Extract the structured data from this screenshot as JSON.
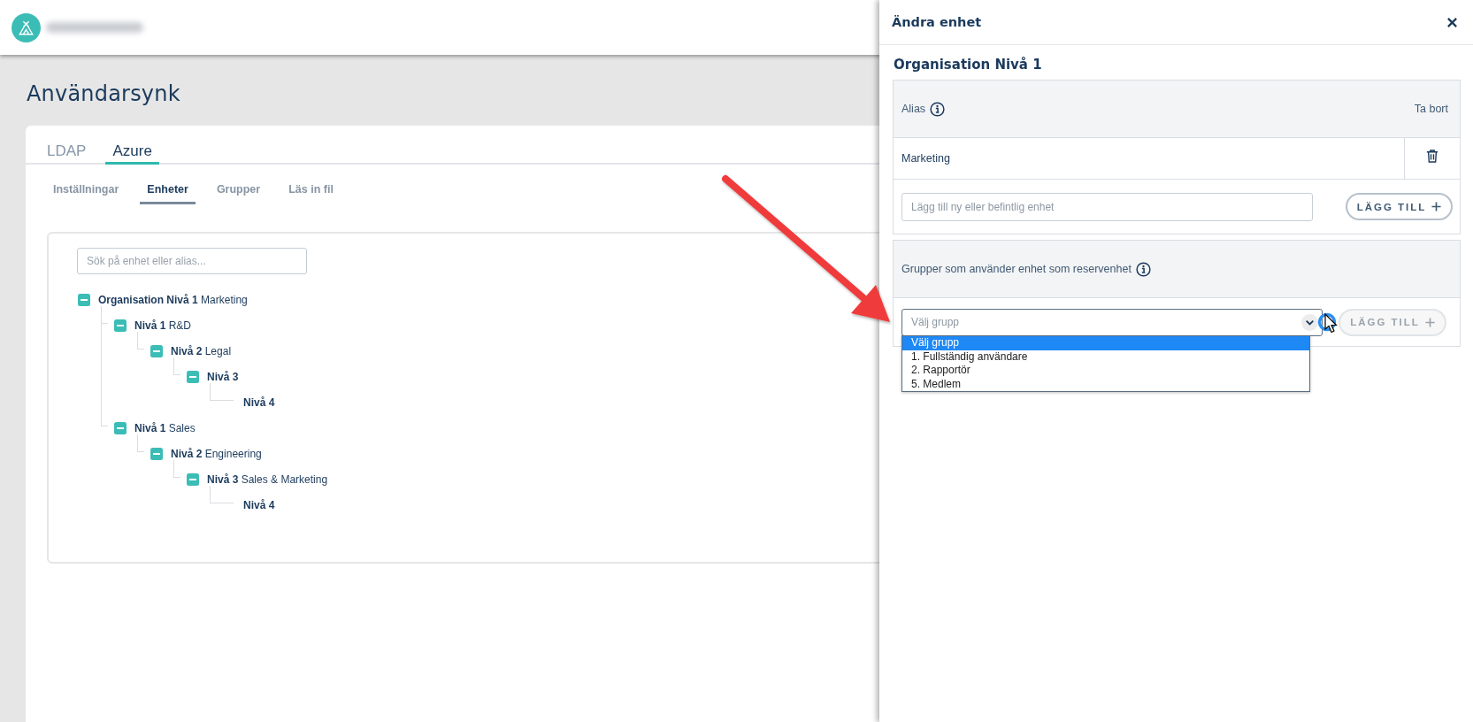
{
  "page_title": "Användarsynk",
  "tabs": [
    {
      "label": "LDAP",
      "selected": false
    },
    {
      "label": "Azure",
      "selected": true
    }
  ],
  "subtabs": [
    {
      "label": "Inställningar",
      "selected": false
    },
    {
      "label": "Enheter",
      "selected": true
    },
    {
      "label": "Grupper",
      "selected": false
    },
    {
      "label": "Läs in fil",
      "selected": false
    }
  ],
  "search": {
    "placeholder": "Sök på enhet eller alias..."
  },
  "tree": [
    {
      "level": "Organisation Nivå 1",
      "name": "Marketing",
      "expanded": true,
      "children": [
        {
          "level": "Nivå 1",
          "name": "R&D",
          "expanded": true,
          "children": [
            {
              "level": "Nivå 2",
              "name": "Legal",
              "expanded": true,
              "children": [
                {
                  "level": "Nivå 3",
                  "expanded": true,
                  "children": [
                    {
                      "level": "Nivå 4"
                    }
                  ]
                }
              ]
            }
          ]
        },
        {
          "level": "Nivå 1",
          "name": "Sales",
          "expanded": true,
          "children": [
            {
              "level": "Nivå 2",
              "name": "Engineering",
              "expanded": true,
              "children": [
                {
                  "level": "Nivå 3",
                  "name": "Sales & Marketing",
                  "expanded": true,
                  "children": [
                    {
                      "level": "Nivå 4"
                    }
                  ]
                }
              ]
            }
          ]
        }
      ]
    }
  ],
  "panel": {
    "title": "Ändra enhet",
    "heading": "Organisation Nivå 1",
    "alias_table": {
      "column": "Alias",
      "action_column": "Ta bort",
      "rows": [
        {
          "alias": "Marketing"
        }
      ],
      "add_placeholder": "Lägg till ny eller befintlig enhet",
      "add_button": {
        "label": "LÄGG TILL",
        "disabled": false
      }
    },
    "groups": {
      "heading": "Grupper som använder enhet som reservenhet",
      "select_placeholder": "Välj grupp",
      "add_button": {
        "label": "LÄGG TILL",
        "disabled": true
      },
      "options": [
        {
          "label": "Välj grupp",
          "selected": true
        },
        {
          "label": "1. Fullständig användare",
          "selected": false
        },
        {
          "label": "2. Rapportör",
          "selected": false
        },
        {
          "label": "5. Medlem",
          "selected": false
        }
      ]
    }
  }
}
